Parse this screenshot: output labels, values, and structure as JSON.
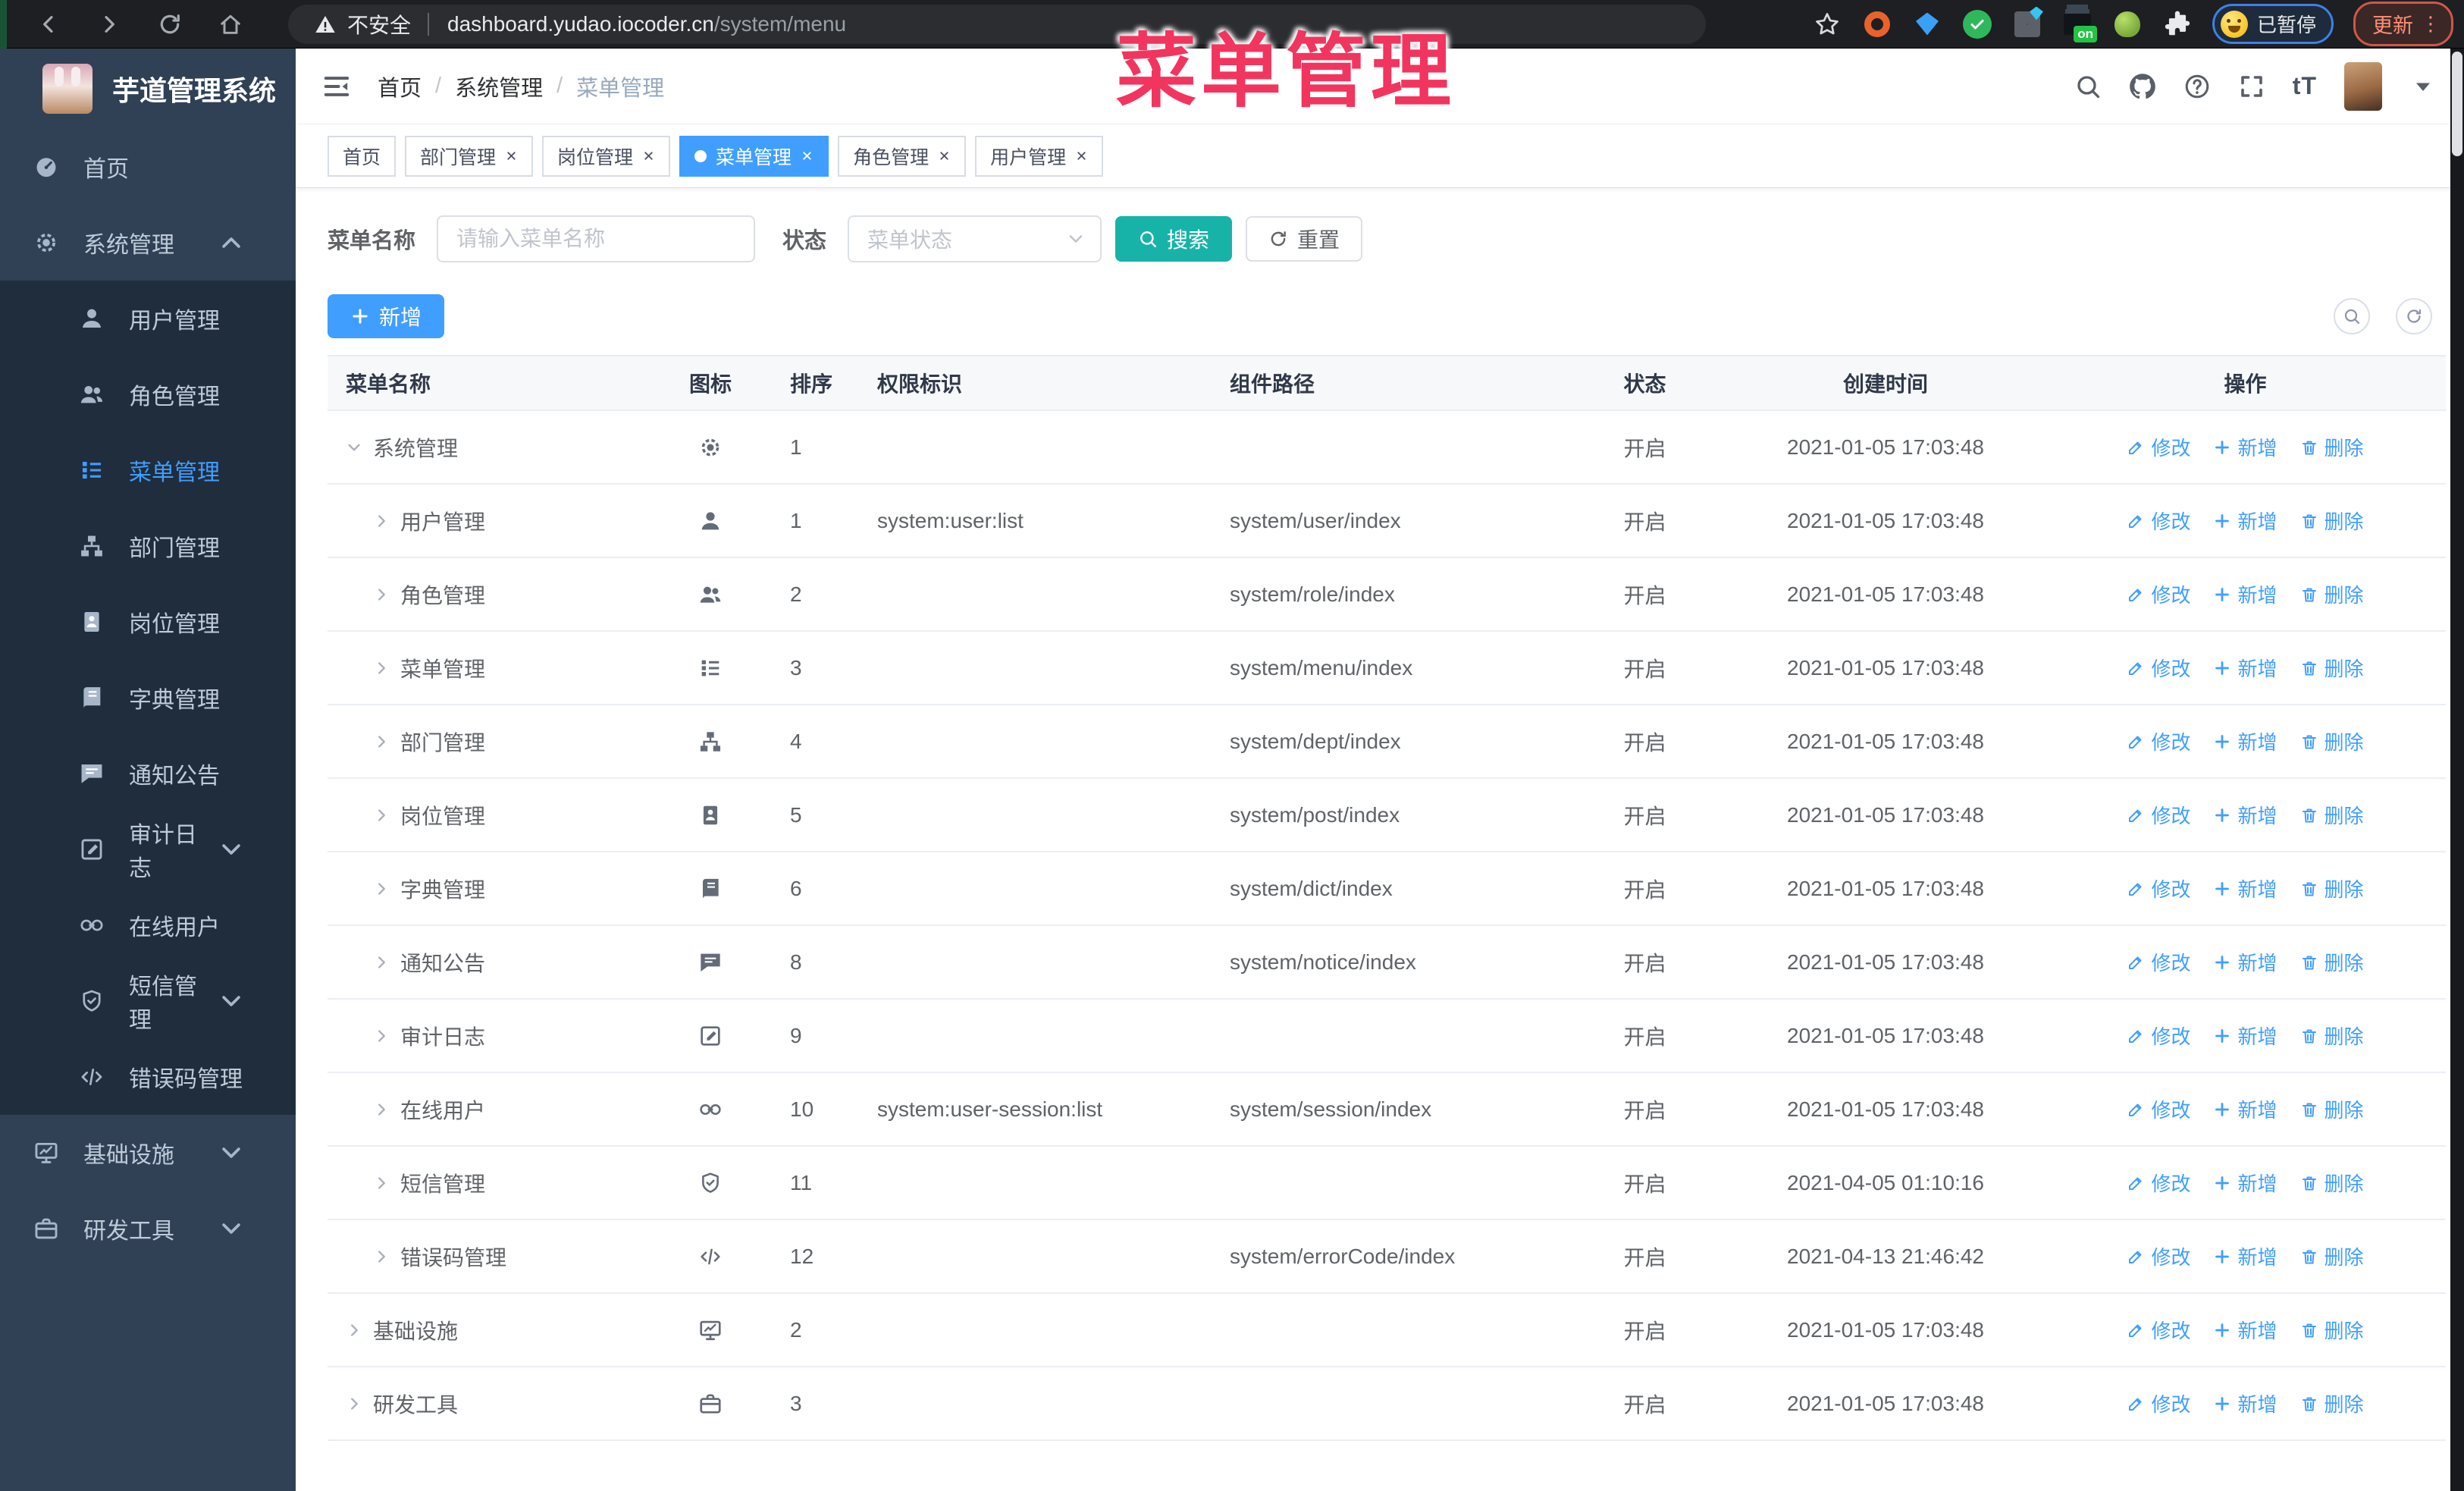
{
  "browser": {
    "security_label": "不安全",
    "url_host": "dashboard.yudao.iocoder.cn",
    "url_path": "/system/menu",
    "on_badge": "on",
    "paused_badge": "已暂停",
    "update_button": "更新"
  },
  "annotation": {
    "text": "菜单管理",
    "color": "#f2355e"
  },
  "app": {
    "logo_title": "芋道管理系统",
    "breadcrumb": [
      "首页",
      "系统管理",
      "菜单管理"
    ],
    "breadcrumb_separator": "/",
    "nav": {
      "font_size_label": "tT"
    },
    "sidebar": {
      "items": [
        {
          "label": "首页",
          "icon": "dashboard-icon",
          "level": 0
        },
        {
          "label": "系统管理",
          "icon": "gear-icon",
          "level": 0,
          "arrow": "up"
        },
        {
          "label": "用户管理",
          "icon": "user-icon",
          "level": 1
        },
        {
          "label": "角色管理",
          "icon": "users-icon",
          "level": 1
        },
        {
          "label": "菜单管理",
          "icon": "list-icon",
          "level": 1,
          "active": true
        },
        {
          "label": "部门管理",
          "icon": "tree-icon",
          "level": 1
        },
        {
          "label": "岗位管理",
          "icon": "badge-icon",
          "level": 1
        },
        {
          "label": "字典管理",
          "icon": "book-icon",
          "level": 1
        },
        {
          "label": "通知公告",
          "icon": "chat-icon",
          "level": 1
        },
        {
          "label": "审计日志",
          "icon": "log-icon",
          "level": 1,
          "arrow": "down"
        },
        {
          "label": "在线用户",
          "icon": "link-icon",
          "level": 1
        },
        {
          "label": "短信管理",
          "icon": "shield-icon",
          "level": 1,
          "arrow": "down"
        },
        {
          "label": "错误码管理",
          "icon": "code-icon",
          "level": 1
        },
        {
          "label": "基础设施",
          "icon": "monitor-icon",
          "level": 0,
          "arrow": "down"
        },
        {
          "label": "研发工具",
          "icon": "tool-icon",
          "level": 0,
          "arrow": "down"
        }
      ]
    },
    "tabs": [
      {
        "label": "首页",
        "active": false,
        "closable": false
      },
      {
        "label": "部门管理",
        "active": false,
        "closable": true
      },
      {
        "label": "岗位管理",
        "active": false,
        "closable": true
      },
      {
        "label": "菜单管理",
        "active": true,
        "closable": true
      },
      {
        "label": "角色管理",
        "active": false,
        "closable": true
      },
      {
        "label": "用户管理",
        "active": false,
        "closable": true
      }
    ],
    "filters": {
      "name_label": "菜单名称",
      "name_placeholder": "请输入菜单名称",
      "status_label": "状态",
      "status_placeholder": "菜单状态",
      "search_button": "搜索",
      "reset_button": "重置"
    },
    "toolbar": {
      "add_button": "新增"
    },
    "table": {
      "columns": [
        "菜单名称",
        "图标",
        "排序",
        "权限标识",
        "组件路径",
        "状态",
        "创建时间",
        "操作"
      ],
      "actions": [
        {
          "label": "修改",
          "icon": "edit-icon"
        },
        {
          "label": "新增",
          "icon": "plus-icon"
        },
        {
          "label": "删除",
          "icon": "delete-icon"
        }
      ],
      "rows": [
        {
          "name": "系统管理",
          "level": 0,
          "caret": "down",
          "icon": "gear-icon",
          "sort": "1",
          "perm": "",
          "path": "",
          "status": "开启",
          "created": "2021-01-05 17:03:48"
        },
        {
          "name": "用户管理",
          "level": 1,
          "caret": "right",
          "icon": "user-icon",
          "sort": "1",
          "perm": "system:user:list",
          "path": "system/user/index",
          "status": "开启",
          "created": "2021-01-05 17:03:48"
        },
        {
          "name": "角色管理",
          "level": 1,
          "caret": "right",
          "icon": "users-icon",
          "sort": "2",
          "perm": "",
          "path": "system/role/index",
          "status": "开启",
          "created": "2021-01-05 17:03:48"
        },
        {
          "name": "菜单管理",
          "level": 1,
          "caret": "right",
          "icon": "list-icon",
          "sort": "3",
          "perm": "",
          "path": "system/menu/index",
          "status": "开启",
          "created": "2021-01-05 17:03:48"
        },
        {
          "name": "部门管理",
          "level": 1,
          "caret": "right",
          "icon": "tree-icon",
          "sort": "4",
          "perm": "",
          "path": "system/dept/index",
          "status": "开启",
          "created": "2021-01-05 17:03:48"
        },
        {
          "name": "岗位管理",
          "level": 1,
          "caret": "right",
          "icon": "badge-icon",
          "sort": "5",
          "perm": "",
          "path": "system/post/index",
          "status": "开启",
          "created": "2021-01-05 17:03:48"
        },
        {
          "name": "字典管理",
          "level": 1,
          "caret": "right",
          "icon": "book-icon",
          "sort": "6",
          "perm": "",
          "path": "system/dict/index",
          "status": "开启",
          "created": "2021-01-05 17:03:48"
        },
        {
          "name": "通知公告",
          "level": 1,
          "caret": "right",
          "icon": "chat-icon",
          "sort": "8",
          "perm": "",
          "path": "system/notice/index",
          "status": "开启",
          "created": "2021-01-05 17:03:48"
        },
        {
          "name": "审计日志",
          "level": 1,
          "caret": "right",
          "icon": "log-icon",
          "sort": "9",
          "perm": "",
          "path": "",
          "status": "开启",
          "created": "2021-01-05 17:03:48"
        },
        {
          "name": "在线用户",
          "level": 1,
          "caret": "right",
          "icon": "link-icon",
          "sort": "10",
          "perm": "system:user-session:list",
          "path": "system/session/index",
          "status": "开启",
          "created": "2021-01-05 17:03:48"
        },
        {
          "name": "短信管理",
          "level": 1,
          "caret": "right",
          "icon": "shield-icon",
          "sort": "11",
          "perm": "",
          "path": "",
          "status": "开启",
          "created": "2021-04-05 01:10:16"
        },
        {
          "name": "错误码管理",
          "level": 1,
          "caret": "right",
          "icon": "code-icon",
          "sort": "12",
          "perm": "",
          "path": "system/errorCode/index",
          "status": "开启",
          "created": "2021-04-13 21:46:42"
        },
        {
          "name": "基础设施",
          "level": 0,
          "caret": "right",
          "icon": "monitor-icon",
          "sort": "2",
          "perm": "",
          "path": "",
          "status": "开启",
          "created": "2021-01-05 17:03:48"
        },
        {
          "name": "研发工具",
          "level": 0,
          "caret": "right",
          "icon": "tool-icon",
          "sort": "3",
          "perm": "",
          "path": "",
          "status": "开启",
          "created": "2021-01-05 17:03:48"
        }
      ]
    }
  }
}
